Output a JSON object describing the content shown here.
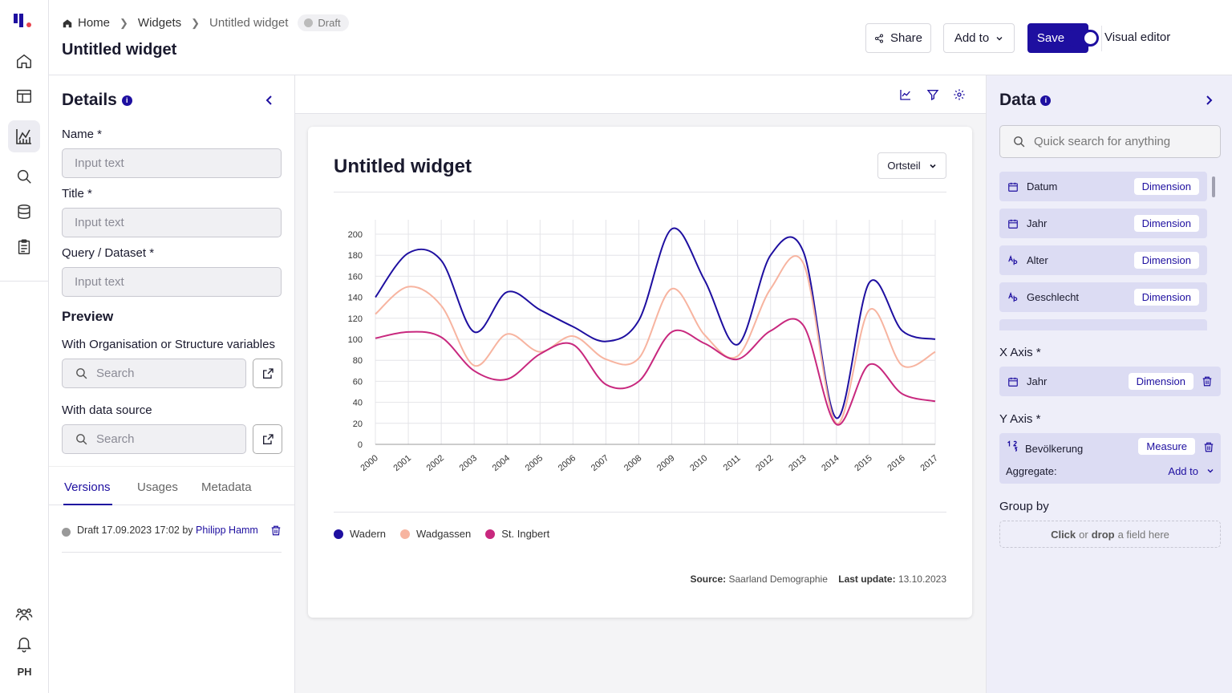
{
  "rail": {
    "user_initials": "PH"
  },
  "breadcrumb": {
    "home": "Home",
    "widgets": "Widgets",
    "current": "Untitled widget",
    "status": "Draft"
  },
  "page_title": "Untitled widget",
  "toolbar": {
    "share": "Share",
    "add_to": "Add to",
    "save": "Save",
    "visual_editor": "Visual editor",
    "visual_editor_on": true
  },
  "details": {
    "title": "Details",
    "name_label": "Name *",
    "name_placeholder": "Input text",
    "title_label": "Title *",
    "title_placeholder": "Input text",
    "query_label": "Query / Dataset *",
    "query_placeholder": "Input text",
    "preview_heading": "Preview",
    "org_label": "With Organisation or Structure variables",
    "org_search": "Search",
    "source_label": "With data source",
    "source_search": "Search",
    "tabs": [
      "Versions",
      "Usages",
      "Metadata"
    ],
    "version": {
      "text": "Draft 17.09.2023 17:02 by",
      "author": "Philipp Hamm"
    }
  },
  "widget": {
    "title": "Untitled widget",
    "dropdown": "Ortsteil",
    "source_label": "Source:",
    "source_value": "Saarland Demographie",
    "update_label": "Last update:",
    "update_value": "13.10.2023"
  },
  "chart_data": {
    "type": "line",
    "x": [
      "2000",
      "2001",
      "2002",
      "2003",
      "2004",
      "2005",
      "2006",
      "2007",
      "2008",
      "2009",
      "2010",
      "2011",
      "2012",
      "2013",
      "2014",
      "2015",
      "2016",
      "2017"
    ],
    "yticks": [
      0,
      20,
      40,
      60,
      80,
      100,
      120,
      140,
      160,
      180,
      200
    ],
    "ylim": [
      0,
      200
    ],
    "series": [
      {
        "name": "Wadern",
        "color": "#1e0fa0",
        "values": [
          140,
          182,
          175,
          107,
          145,
          128,
          112,
          98,
          118,
          205,
          156,
          95,
          180,
          183,
          25,
          154,
          108,
          100
        ]
      },
      {
        "name": "Wadgassen",
        "color": "#f7b4a0",
        "values": [
          124,
          150,
          132,
          75,
          105,
          88,
          103,
          81,
          82,
          148,
          104,
          84,
          148,
          172,
          20,
          128,
          75,
          88
        ]
      },
      {
        "name": "St. Ingbert",
        "color": "#c8287e",
        "values": [
          101,
          107,
          102,
          70,
          62,
          86,
          95,
          57,
          60,
          107,
          96,
          81,
          108,
          113,
          19,
          76,
          48,
          41
        ]
      }
    ],
    "grid": true,
    "legend": "bottom-left"
  },
  "data_panel": {
    "title": "Data",
    "search_placeholder": "Quick search for anything",
    "fields": [
      {
        "icon": "calendar-icon",
        "name": "Datum",
        "type": "Dimension"
      },
      {
        "icon": "calendar-icon",
        "name": "Jahr",
        "type": "Dimension"
      },
      {
        "icon": "text-type-icon",
        "name": "Alter",
        "type": "Dimension"
      },
      {
        "icon": "text-type-icon",
        "name": "Geschlecht",
        "type": "Dimension"
      }
    ],
    "x_axis_label": "X Axis *",
    "x_field": {
      "name": "Jahr",
      "type": "Dimension"
    },
    "y_axis_label": "Y Axis *",
    "y_field": {
      "name": "Bevölkerung",
      "type": "Measure",
      "aggregate_label": "Aggregate:",
      "aggregate_value": "Add to"
    },
    "group_by_label": "Group by",
    "drop_click": "Click",
    "drop_or": "or",
    "drop_drop": "drop",
    "drop_rest": "a field here"
  }
}
